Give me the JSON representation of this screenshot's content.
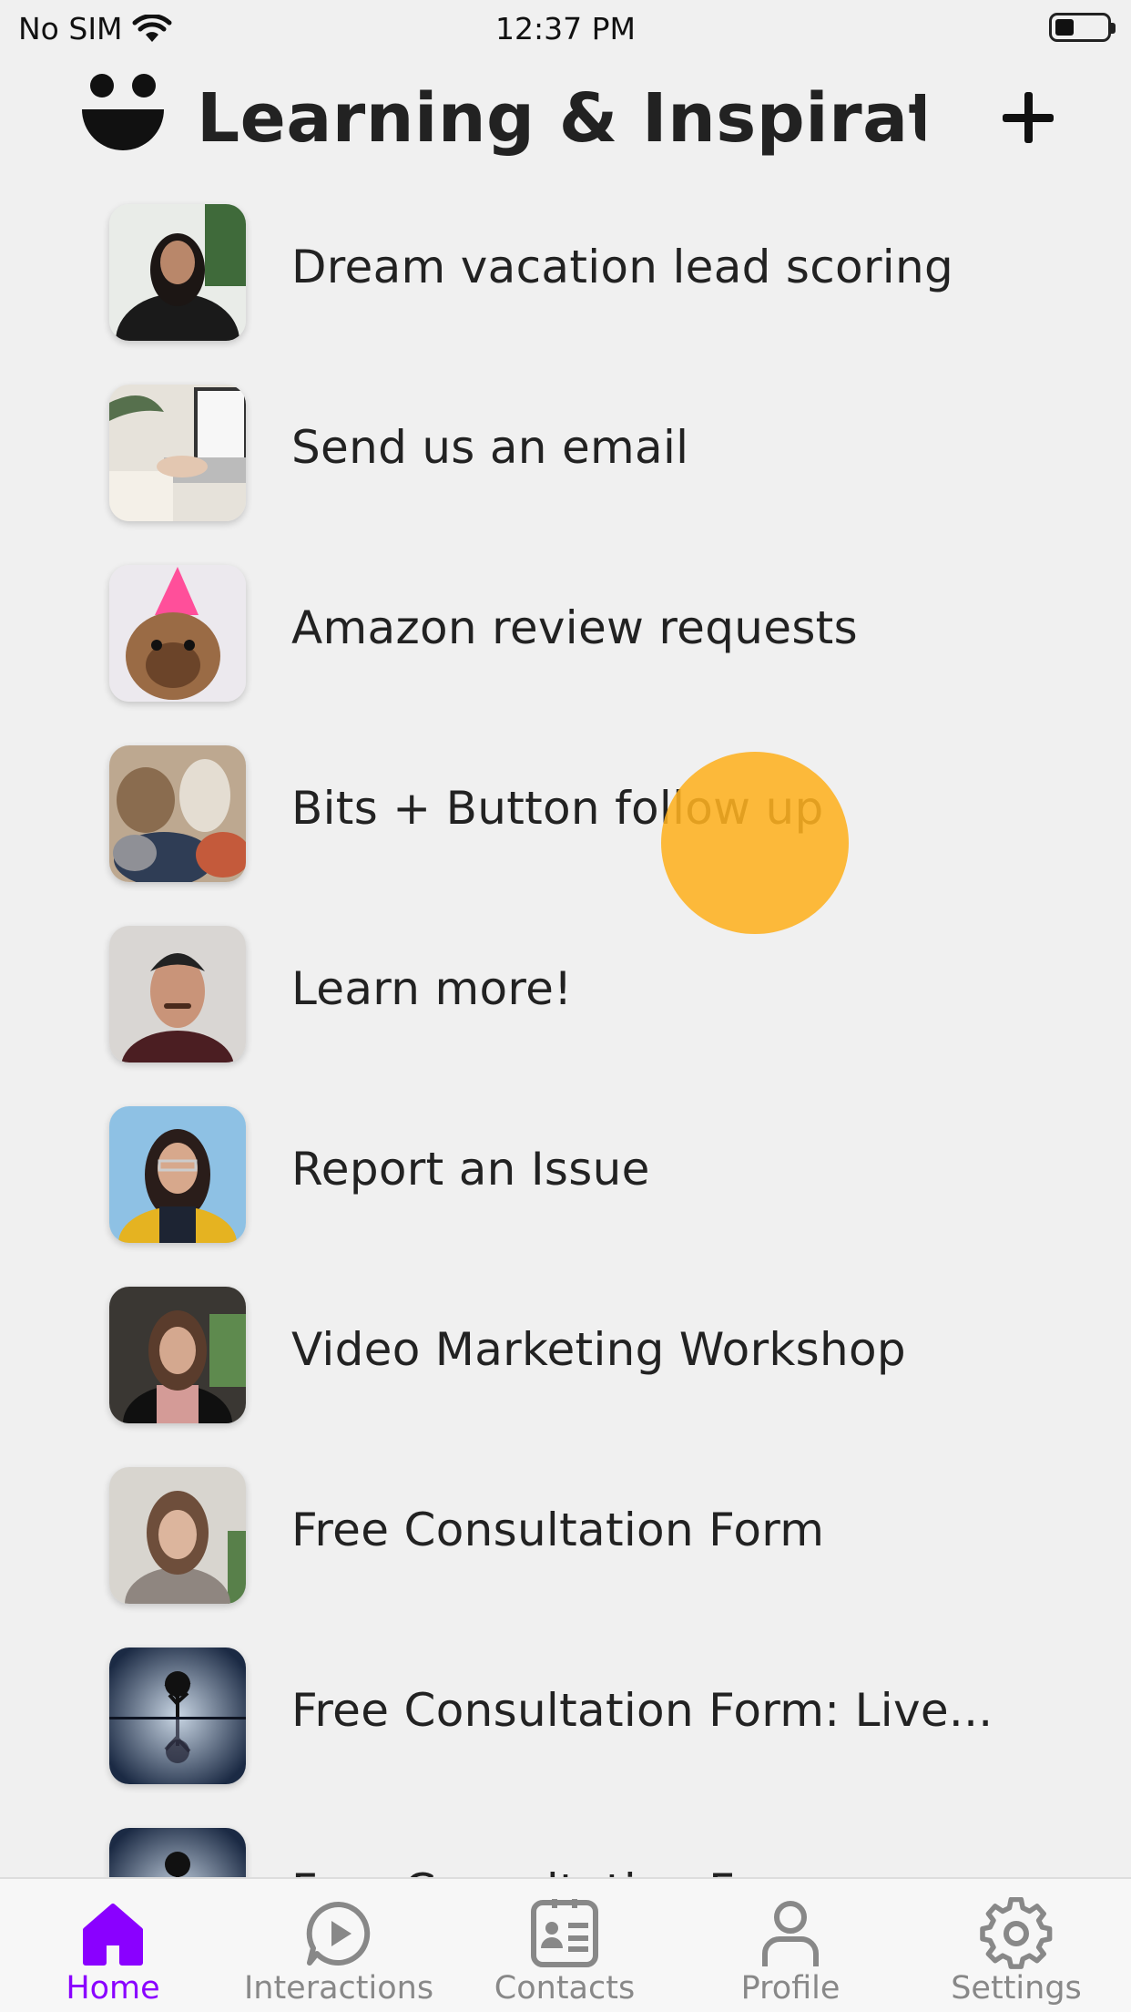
{
  "status_bar": {
    "carrier": "No SIM",
    "time": "12:37 PM"
  },
  "header": {
    "title": "Learning & Inspirati...",
    "logo_icon": "smiley-logo-icon",
    "add_icon": "plus-icon"
  },
  "videos": [
    {
      "title": "Dream vacation lead scoring",
      "thumb": "woman-portrait"
    },
    {
      "title": "Send us an email",
      "thumb": "laptop-desk"
    },
    {
      "title": "Amazon review requests",
      "thumb": "dog-party-hat"
    },
    {
      "title": "Bits + Button follow up",
      "thumb": "plush-toys"
    },
    {
      "title": "Learn more!",
      "thumb": "man-portrait"
    },
    {
      "title": "Report an Issue",
      "thumb": "woman-glasses"
    },
    {
      "title": "Video Marketing Workshop",
      "thumb": "woman-dark-bg"
    },
    {
      "title": "Free Consultation Form",
      "thumb": "woman-light-bg"
    },
    {
      "title": "Free Consultation Form: Live...",
      "thumb": "tree-reflection"
    },
    {
      "title": "Free Consultation Form",
      "thumb": "tree-reflection"
    }
  ],
  "tabs": [
    {
      "label": "Home",
      "icon": "house-icon",
      "active": true
    },
    {
      "label": "Interactions",
      "icon": "play-bubble-icon",
      "active": false
    },
    {
      "label": "Contacts",
      "icon": "contact-card-icon",
      "active": false
    },
    {
      "label": "Profile",
      "icon": "person-icon",
      "active": false
    },
    {
      "label": "Settings",
      "icon": "gear-icon",
      "active": false
    }
  ],
  "colors": {
    "accent": "#8a00ff",
    "inactive": "#888888",
    "touch": "#fdb020",
    "background": "#f0f0f0"
  }
}
